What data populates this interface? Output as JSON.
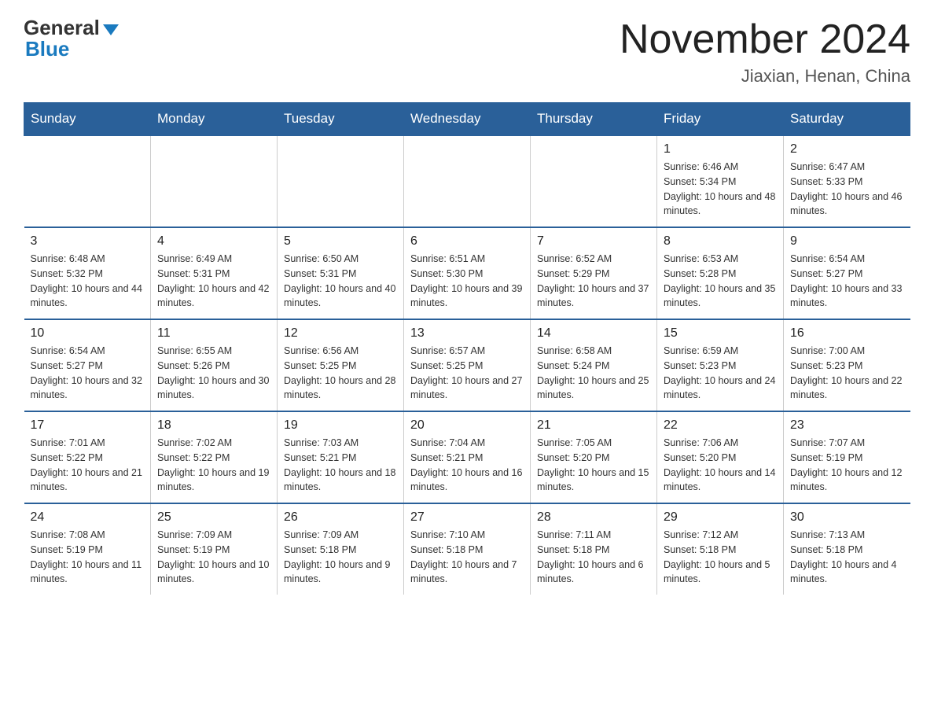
{
  "header": {
    "logo_general": "General",
    "logo_blue": "Blue",
    "month_title": "November 2024",
    "location": "Jiaxian, Henan, China"
  },
  "weekdays": [
    "Sunday",
    "Monday",
    "Tuesday",
    "Wednesday",
    "Thursday",
    "Friday",
    "Saturday"
  ],
  "weeks": [
    [
      {
        "day": "",
        "info": ""
      },
      {
        "day": "",
        "info": ""
      },
      {
        "day": "",
        "info": ""
      },
      {
        "day": "",
        "info": ""
      },
      {
        "day": "",
        "info": ""
      },
      {
        "day": "1",
        "info": "Sunrise: 6:46 AM\nSunset: 5:34 PM\nDaylight: 10 hours and 48 minutes."
      },
      {
        "day": "2",
        "info": "Sunrise: 6:47 AM\nSunset: 5:33 PM\nDaylight: 10 hours and 46 minutes."
      }
    ],
    [
      {
        "day": "3",
        "info": "Sunrise: 6:48 AM\nSunset: 5:32 PM\nDaylight: 10 hours and 44 minutes."
      },
      {
        "day": "4",
        "info": "Sunrise: 6:49 AM\nSunset: 5:31 PM\nDaylight: 10 hours and 42 minutes."
      },
      {
        "day": "5",
        "info": "Sunrise: 6:50 AM\nSunset: 5:31 PM\nDaylight: 10 hours and 40 minutes."
      },
      {
        "day": "6",
        "info": "Sunrise: 6:51 AM\nSunset: 5:30 PM\nDaylight: 10 hours and 39 minutes."
      },
      {
        "day": "7",
        "info": "Sunrise: 6:52 AM\nSunset: 5:29 PM\nDaylight: 10 hours and 37 minutes."
      },
      {
        "day": "8",
        "info": "Sunrise: 6:53 AM\nSunset: 5:28 PM\nDaylight: 10 hours and 35 minutes."
      },
      {
        "day": "9",
        "info": "Sunrise: 6:54 AM\nSunset: 5:27 PM\nDaylight: 10 hours and 33 minutes."
      }
    ],
    [
      {
        "day": "10",
        "info": "Sunrise: 6:54 AM\nSunset: 5:27 PM\nDaylight: 10 hours and 32 minutes."
      },
      {
        "day": "11",
        "info": "Sunrise: 6:55 AM\nSunset: 5:26 PM\nDaylight: 10 hours and 30 minutes."
      },
      {
        "day": "12",
        "info": "Sunrise: 6:56 AM\nSunset: 5:25 PM\nDaylight: 10 hours and 28 minutes."
      },
      {
        "day": "13",
        "info": "Sunrise: 6:57 AM\nSunset: 5:25 PM\nDaylight: 10 hours and 27 minutes."
      },
      {
        "day": "14",
        "info": "Sunrise: 6:58 AM\nSunset: 5:24 PM\nDaylight: 10 hours and 25 minutes."
      },
      {
        "day": "15",
        "info": "Sunrise: 6:59 AM\nSunset: 5:23 PM\nDaylight: 10 hours and 24 minutes."
      },
      {
        "day": "16",
        "info": "Sunrise: 7:00 AM\nSunset: 5:23 PM\nDaylight: 10 hours and 22 minutes."
      }
    ],
    [
      {
        "day": "17",
        "info": "Sunrise: 7:01 AM\nSunset: 5:22 PM\nDaylight: 10 hours and 21 minutes."
      },
      {
        "day": "18",
        "info": "Sunrise: 7:02 AM\nSunset: 5:22 PM\nDaylight: 10 hours and 19 minutes."
      },
      {
        "day": "19",
        "info": "Sunrise: 7:03 AM\nSunset: 5:21 PM\nDaylight: 10 hours and 18 minutes."
      },
      {
        "day": "20",
        "info": "Sunrise: 7:04 AM\nSunset: 5:21 PM\nDaylight: 10 hours and 16 minutes."
      },
      {
        "day": "21",
        "info": "Sunrise: 7:05 AM\nSunset: 5:20 PM\nDaylight: 10 hours and 15 minutes."
      },
      {
        "day": "22",
        "info": "Sunrise: 7:06 AM\nSunset: 5:20 PM\nDaylight: 10 hours and 14 minutes."
      },
      {
        "day": "23",
        "info": "Sunrise: 7:07 AM\nSunset: 5:19 PM\nDaylight: 10 hours and 12 minutes."
      }
    ],
    [
      {
        "day": "24",
        "info": "Sunrise: 7:08 AM\nSunset: 5:19 PM\nDaylight: 10 hours and 11 minutes."
      },
      {
        "day": "25",
        "info": "Sunrise: 7:09 AM\nSunset: 5:19 PM\nDaylight: 10 hours and 10 minutes."
      },
      {
        "day": "26",
        "info": "Sunrise: 7:09 AM\nSunset: 5:18 PM\nDaylight: 10 hours and 9 minutes."
      },
      {
        "day": "27",
        "info": "Sunrise: 7:10 AM\nSunset: 5:18 PM\nDaylight: 10 hours and 7 minutes."
      },
      {
        "day": "28",
        "info": "Sunrise: 7:11 AM\nSunset: 5:18 PM\nDaylight: 10 hours and 6 minutes."
      },
      {
        "day": "29",
        "info": "Sunrise: 7:12 AM\nSunset: 5:18 PM\nDaylight: 10 hours and 5 minutes."
      },
      {
        "day": "30",
        "info": "Sunrise: 7:13 AM\nSunset: 5:18 PM\nDaylight: 10 hours and 4 minutes."
      }
    ]
  ]
}
